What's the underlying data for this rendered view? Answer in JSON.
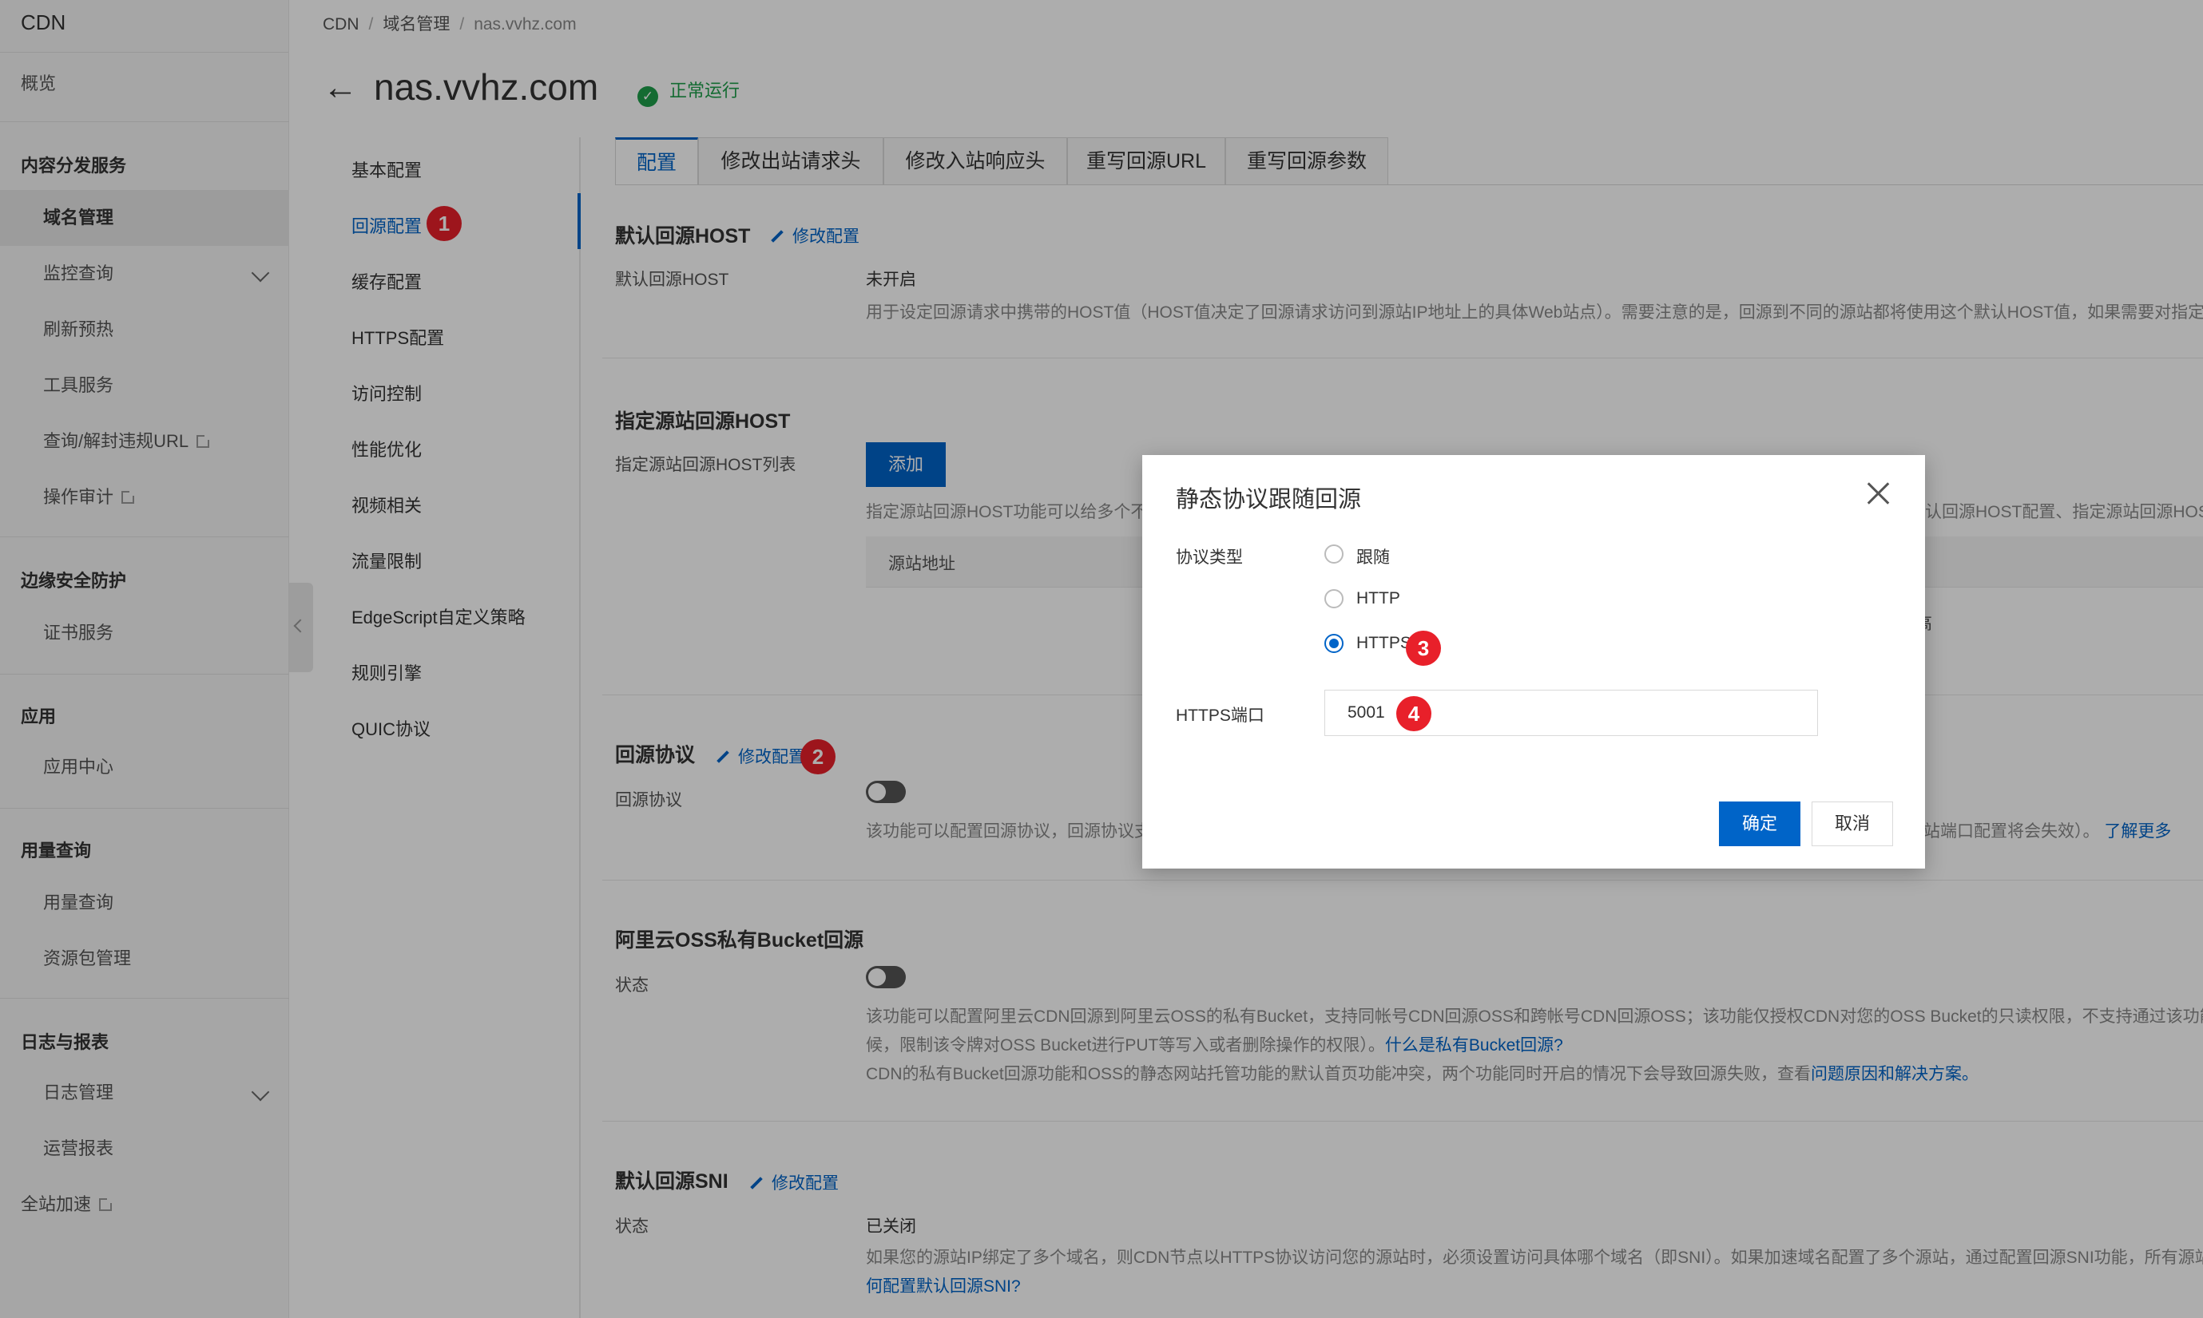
{
  "sidebar": {
    "title": "CDN",
    "overview": "概览",
    "groups": [
      "内容分发服务",
      "边缘安全防护",
      "应用",
      "用量查询",
      "日志与报表"
    ],
    "items": {
      "domain_mgmt": "域名管理",
      "monitor": "监控查询",
      "refresh": "刷新预热",
      "tools": "工具服务",
      "query_url": "查询/解封违规URL",
      "audit": "操作审计",
      "cert": "证书服务",
      "app_center": "应用中心",
      "usage_query": "用量查询",
      "package": "资源包管理",
      "log_mgmt": "日志管理",
      "ops_report": "运营报表",
      "dcdn": "全站加速"
    }
  },
  "breadcrumb": [
    "CDN",
    "域名管理",
    "nas.vvhz.com"
  ],
  "header": {
    "domain": "nas.vvhz.com",
    "status": "正常运行",
    "status_icon": "check-circle-icon",
    "status_color": "#1e9e4a"
  },
  "subnav": [
    "基本配置",
    "回源配置",
    "缓存配置",
    "HTTPS配置",
    "访问控制",
    "性能优化",
    "视频相关",
    "流量限制",
    "EdgeScript自定义策略",
    "规则引擎",
    "QUIC协议"
  ],
  "tabs": [
    "配置",
    "修改出站请求头",
    "修改入站响应头",
    "重写回源URL",
    "重写回源参数"
  ],
  "edit_label": "修改配置",
  "sections": {
    "host": {
      "title": "默认回源HOST",
      "label": "默认回源HOST",
      "value": "未开启",
      "desc": "用于设定回源请求中携带的HOST值（HOST值决定了回源请求访问到源站IP地址上的具体Web站点）。需要注意的是，回源到不同的源站都将使用这个默认HOST值，如果需要对指定"
    },
    "origin_host": {
      "title": "指定源站回源HOST",
      "label": "指定源站回源HOST列表",
      "add_btn": "添加",
      "desc_left": "指定源站回源HOST功能可以给多个不",
      "desc_right": "认回源HOST配置、指定源站回源HOST",
      "col": "源站地址",
      "cell_fragment": "高"
    },
    "protocol": {
      "title": "回源协议",
      "label": "回源协议",
      "desc_left": "该功能可以配置回源协议，回源协议支",
      "desc_right": "站端口配置将会失效）。",
      "more_link": "了解更多"
    },
    "oss": {
      "title": "阿里云OSS私有Bucket回源",
      "label": "状态",
      "desc1": "该功能可以配置阿里云CDN回源到阿里云OSS的私有Bucket，支持同帐号CDN回源OSS和跨帐号CDN回源OSS；该功能仅授权CDN对您的OSS Bucket的只读权限，不支持通过该功能对",
      "desc2": "候，限制该令牌对OSS Bucket进行PUT等写入或者删除操作的权限）。",
      "link1": "什么是私有Bucket回源?",
      "desc3": "CDN的私有Bucket回源功能和OSS的静态网站托管功能的默认首页功能冲突，两个功能同时开启的情况下会导致回源失败，查看",
      "link2": "问题原因和解决方案。"
    },
    "sni": {
      "title": "默认回源SNI",
      "label": "状态",
      "value": "已关闭",
      "desc": "如果您的源站IP绑定了多个域名，则CDN节点以HTTPS协议访问您的源站时，必须设置访问具体哪个域名（即SNI）。如果加速域名配置了多个源站，通过配置回源SNI功能，所有源站",
      "link": "何配置默认回源SNI?"
    }
  },
  "modal": {
    "title": "静态协议跟随回源",
    "protocol_label": "协议类型",
    "options": [
      "跟随",
      "HTTP",
      "HTTPS"
    ],
    "selected": "HTTPS",
    "port_label": "HTTPS端口",
    "port_value": "5001",
    "ok": "确定",
    "cancel": "取消"
  },
  "annotations": [
    "1",
    "2",
    "3",
    "4"
  ],
  "colors": {
    "primary": "#0064c8",
    "badge": "#e8202a"
  }
}
